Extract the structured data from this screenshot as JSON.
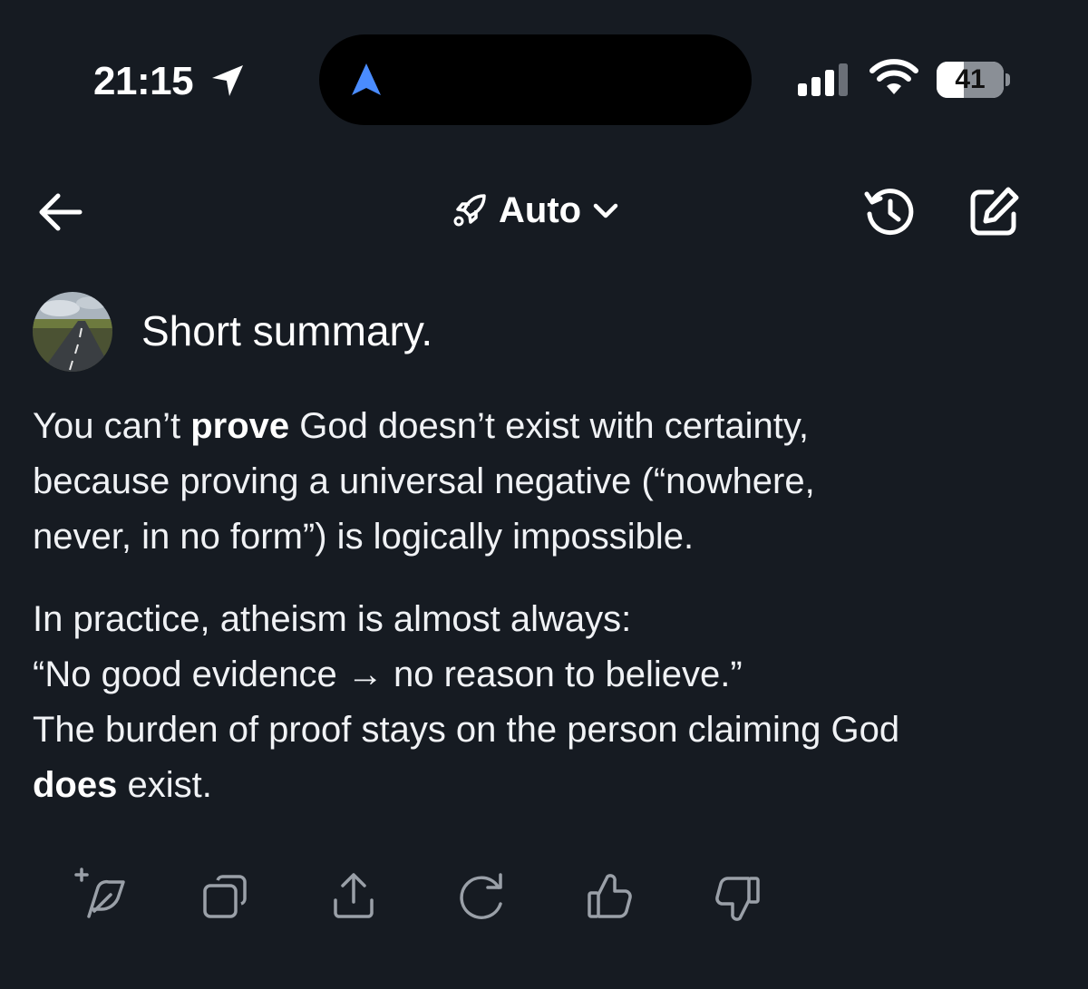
{
  "status_bar": {
    "time": "21:15",
    "battery_level": "41",
    "battery_fraction": 0.41
  },
  "header": {
    "model_label": "Auto",
    "icons": [
      "back-arrow-icon",
      "rocket-icon",
      "chevron-down-icon",
      "history-icon",
      "edit-icon"
    ]
  },
  "conversation": {
    "user_message": "Short summary.",
    "response": {
      "p1": {
        "t1": "You can’t ",
        "b1": "prove",
        "t2": " God doesn’t exist with certainty,",
        "l2": "because proving a universal negative (“nowhere,",
        "l3": "never, in no form”) is logically impossible."
      },
      "p2": {
        "l1": "In practice, atheism is almost always:",
        "l2": "“No good evidence → no reason to believe.”",
        "l3": "The burden of proof stays on the person claiming God",
        "b1": "does",
        "t4": " exist."
      }
    }
  },
  "actions": [
    "add-sparkle-icon",
    "copy-icon",
    "share-icon",
    "regenerate-icon",
    "thumbs-up-icon",
    "thumbs-down-icon"
  ],
  "colors": {
    "background": "#161b22",
    "text": "#f2f4f7",
    "icon_muted": "#9aa0a8",
    "nav_accent": "#4a8cff"
  }
}
